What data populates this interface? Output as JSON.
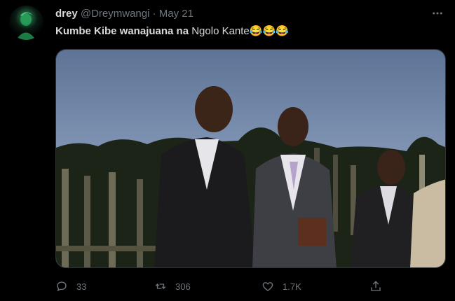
{
  "tweet": {
    "author_name": "drey",
    "handle": "@Dreymwangi",
    "separator": "·",
    "date": "May 21",
    "more_icon": "more-icon",
    "text_bold": "Kumbe Kibe wanajuana na",
    "text_rest": " Ngolo Kante",
    "emojis": "😂😂😂",
    "media_alt_icon": "photo",
    "counts": {
      "replies": "33",
      "retweets": "306",
      "likes": "1.7K"
    }
  },
  "colors": {
    "background": "#000000",
    "text": "#d9d9d9",
    "muted": "#6e767d",
    "border": "#2f3336"
  }
}
